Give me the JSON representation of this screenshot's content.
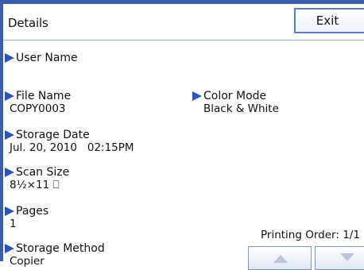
{
  "header": {
    "title": "Details",
    "exit_label": "Exit"
  },
  "details": {
    "user_name": {
      "label": "User Name",
      "value": ""
    },
    "file_name": {
      "label": "File Name",
      "value": "COPY0003"
    },
    "color_mode": {
      "label": "Color Mode",
      "value": "Black & White"
    },
    "storage_date": {
      "label": "Storage Date",
      "value": "Jul. 20, 2010   02:15PM"
    },
    "scan_size": {
      "label": "Scan Size",
      "value": "8½×11 ⎕"
    },
    "pages": {
      "label": "Pages",
      "value": "1"
    },
    "storage_method": {
      "label": "Storage Method",
      "value": "Copier"
    }
  },
  "printing_order": {
    "label": "Printing Order:",
    "value": "1/1"
  },
  "icons": {
    "bullet": "triangle-right-icon",
    "scroll_up": "arrow-up-icon",
    "scroll_down": "arrow-down-icon"
  },
  "colors": {
    "frame_blue": "#3a5fa8",
    "bullet_blue": "#2b55b8",
    "button_border": "#5d7fc0"
  }
}
